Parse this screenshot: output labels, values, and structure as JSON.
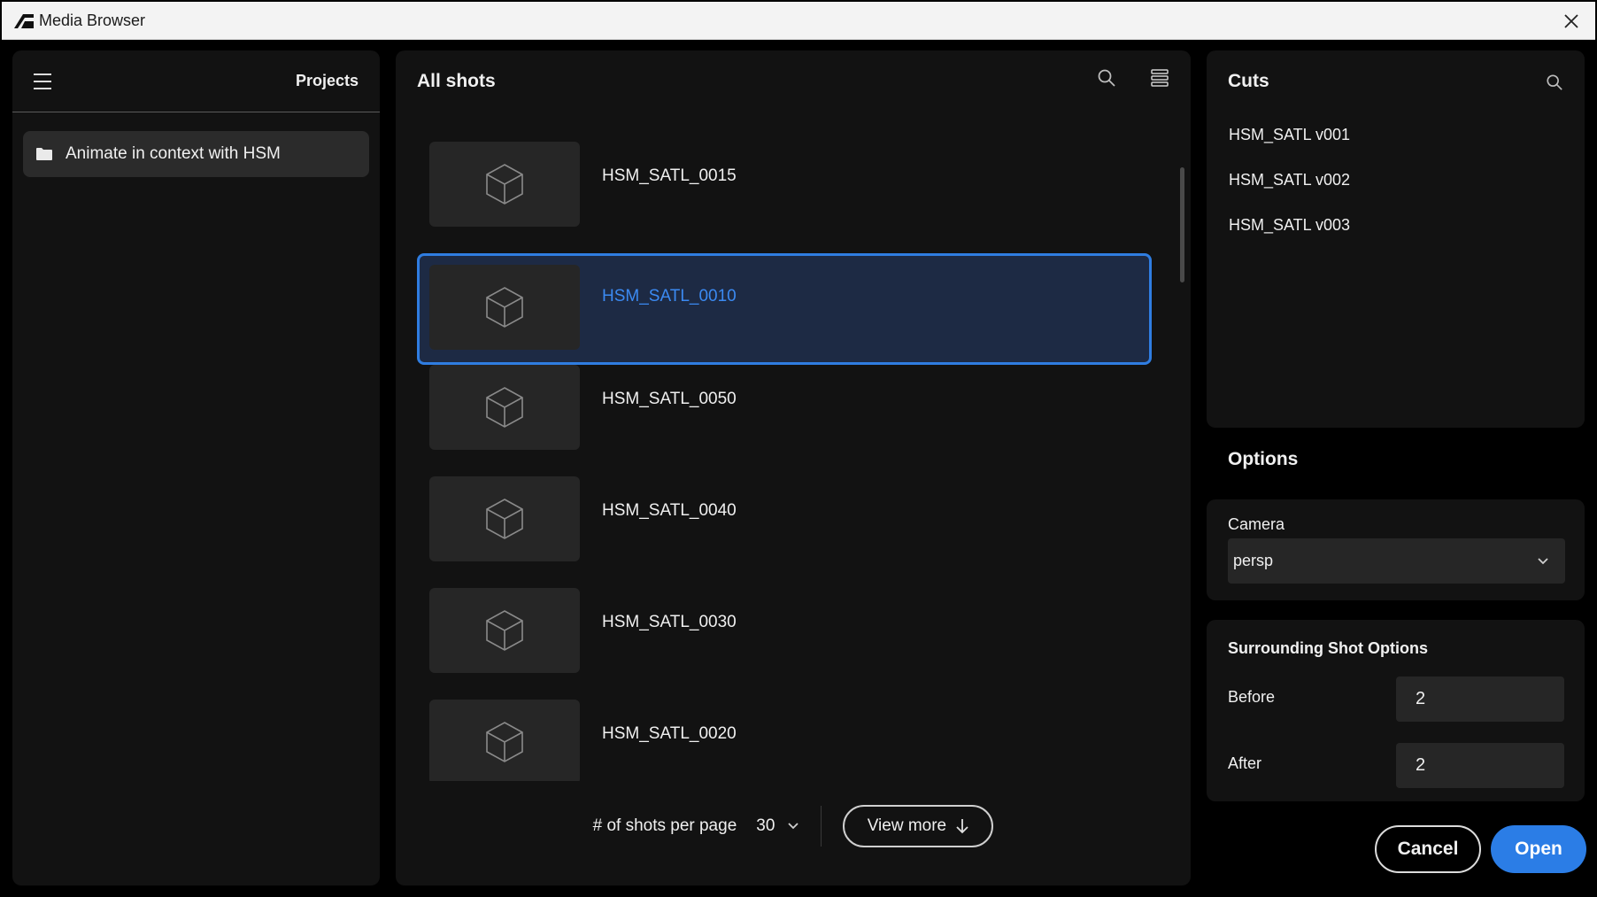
{
  "window": {
    "title": "Media Browser"
  },
  "projects": {
    "header": "Projects",
    "items": [
      {
        "label": "Animate in context with HSM"
      }
    ]
  },
  "shots": {
    "header": "All shots",
    "items": [
      {
        "name": "HSM_SATL_0015",
        "selected": false
      },
      {
        "name": "HSM_SATL_0010",
        "selected": true
      },
      {
        "name": "HSM_SATL_0050",
        "selected": false
      },
      {
        "name": "HSM_SATL_0040",
        "selected": false
      },
      {
        "name": "HSM_SATL_0030",
        "selected": false
      },
      {
        "name": "HSM_SATL_0020",
        "selected": false
      }
    ],
    "footer": {
      "per_page_label": "# of shots per page",
      "per_page_value": "30",
      "view_more_label": "View more"
    }
  },
  "cuts": {
    "header": "Cuts",
    "items": [
      "HSM_SATL v001",
      "HSM_SATL v002",
      "HSM_SATL v003"
    ]
  },
  "options": {
    "title": "Options",
    "camera": {
      "label": "Camera",
      "value": "persp"
    },
    "surrounding": {
      "title": "Surrounding Shot Options",
      "before_label": "Before",
      "before_value": "2",
      "after_label": "After",
      "after_value": "2"
    }
  },
  "actions": {
    "cancel_label": "Cancel",
    "open_label": "Open"
  },
  "colors": {
    "accent": "#2b7de6",
    "selected_bg": "#1d2a44",
    "panel_bg": "#121212"
  },
  "icons": {
    "app_logo": "autodesk-logo-icon",
    "close": "close-icon",
    "menu": "hamburger-menu-icon",
    "folder": "folder-icon",
    "search": "search-icon",
    "list_view": "list-view-icon",
    "thumbnail": "cube-icon",
    "chevron": "chevron-down-icon",
    "arrow_down": "arrow-down-icon"
  }
}
